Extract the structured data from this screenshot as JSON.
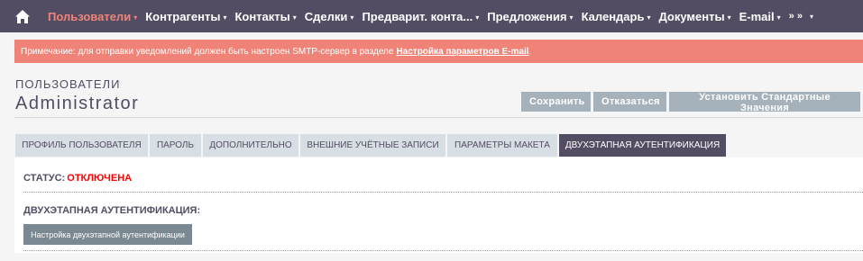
{
  "nav": {
    "home_icon": "home-icon",
    "items": [
      {
        "label": "Пользователи",
        "active": true
      },
      {
        "label": "Контрагенты"
      },
      {
        "label": "Контакты"
      },
      {
        "label": "Сделки"
      },
      {
        "label": "Предварит. конта..."
      },
      {
        "label": "Предложения"
      },
      {
        "label": "Календарь"
      },
      {
        "label": "Документы"
      },
      {
        "label": "E-mail"
      }
    ],
    "more_label": "» »",
    "caret": "▾",
    "active_color": "#f08377"
  },
  "notice": {
    "text": "Примечание: для отправки уведомлений должен быть настроен SMTP-сервер в разделе",
    "link": "Настройка параметров E-mail",
    "end": "."
  },
  "header": {
    "module": "ПОЛЬЗОВАТЕЛИ",
    "record": "Administrator",
    "save": "Сохранить",
    "cancel": "Отказаться",
    "defaults": "Установить Стандартные Значения"
  },
  "tabs": [
    {
      "label": "ПРОФИЛЬ ПОЛЬЗОВАТЕЛЯ"
    },
    {
      "label": "ПАРОЛЬ"
    },
    {
      "label": "ДОПОЛНИТЕЛЬНО"
    },
    {
      "label": "ВНЕШНИЕ УЧЁТНЫЕ ЗАПИСИ"
    },
    {
      "label": "ПАРАМЕТРЫ МАКЕТА"
    },
    {
      "label": "ДВУХЭТАПНАЯ АУТЕНТИФИКАЦИЯ",
      "active": true
    }
  ],
  "panel": {
    "status_label": "СТАТУС:",
    "status_value": "ОТКЛЮЧЕНА",
    "status_color": "#ff0000",
    "twofa_label": "ДВУХЭТАПНАЯ АУТЕНТИФИКАЦИЯ:",
    "setup_button": "Настройка двухэтапной аутентификации"
  }
}
